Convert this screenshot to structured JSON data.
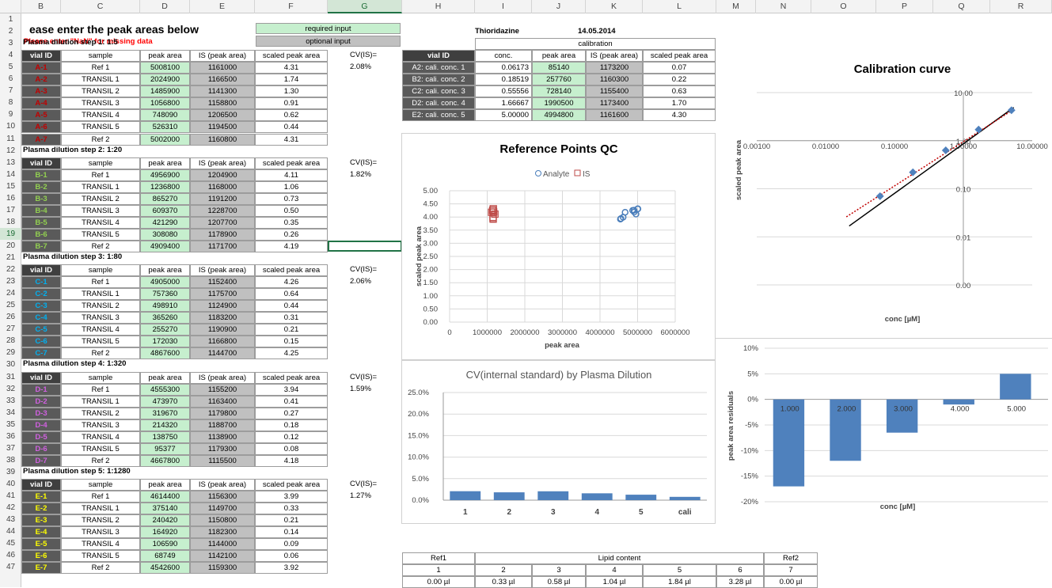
{
  "columns": [
    "",
    "B",
    "C",
    "D",
    "E",
    "F",
    "G",
    "H",
    "I",
    "J",
    "K",
    "L",
    "M",
    "N",
    "O",
    "P",
    "Q",
    "R"
  ],
  "rows": [
    "1",
    "2",
    "3",
    "4",
    "5",
    "6",
    "7",
    "8",
    "9",
    "10",
    "11",
    "12",
    "13",
    "14",
    "15",
    "16",
    "17",
    "18",
    "19",
    "20",
    "21",
    "22",
    "23",
    "24",
    "25",
    "26",
    "27",
    "28",
    "29",
    "30",
    "31",
    "32",
    "33",
    "34",
    "35",
    "36",
    "37",
    "38",
    "39",
    "40",
    "41",
    "42",
    "43",
    "44",
    "45",
    "46",
    "47"
  ],
  "title": "ease enter the peak areas below",
  "nan_note": "Please enter \"NaN\" for missing data",
  "legend_required": "required input",
  "legend_optional": "optional input",
  "drug": "Thioridazine",
  "date": "14.05.2014",
  "headers": {
    "vial": "vial ID",
    "sample": "sample",
    "peak": "peak area",
    "is": "IS (peak area)",
    "scaled": "scaled peak area",
    "cv": "CV(IS)="
  },
  "colors": {
    "A": "#c00000",
    "B": "#92d050",
    "C": "#00b0f0",
    "D": "#d060e0",
    "E": "#ffff00"
  },
  "steps": [
    {
      "label": "Plasma dilution step 1:  1:5",
      "cv": "2.08%",
      "rows": [
        [
          "A-1",
          "Ref 1",
          "5008100",
          "1161000",
          "4.31"
        ],
        [
          "A-2",
          "TRANSIL 1",
          "2024900",
          "1166500",
          "1.74"
        ],
        [
          "A-3",
          "TRANSIL 2",
          "1485900",
          "1141300",
          "1.30"
        ],
        [
          "A-4",
          "TRANSIL 3",
          "1056800",
          "1158800",
          "0.91"
        ],
        [
          "A-5",
          "TRANSIL 4",
          "748090",
          "1206500",
          "0.62"
        ],
        [
          "A-6",
          "TRANSIL 5",
          "526310",
          "1194500",
          "0.44"
        ],
        [
          "A-7",
          "Ref 2",
          "5002000",
          "1160800",
          "4.31"
        ]
      ]
    },
    {
      "label": "Plasma dilution step 2:  1:20",
      "cv": "1.82%",
      "rows": [
        [
          "B-1",
          "Ref 1",
          "4956900",
          "1204900",
          "4.11"
        ],
        [
          "B-2",
          "TRANSIL 1",
          "1236800",
          "1168000",
          "1.06"
        ],
        [
          "B-3",
          "TRANSIL 2",
          "865270",
          "1191200",
          "0.73"
        ],
        [
          "B-4",
          "TRANSIL 3",
          "609370",
          "1228700",
          "0.50"
        ],
        [
          "B-5",
          "TRANSIL 4",
          "421290",
          "1207700",
          "0.35"
        ],
        [
          "B-6",
          "TRANSIL 5",
          "308080",
          "1178900",
          "0.26"
        ],
        [
          "B-7",
          "Ref 2",
          "4909400",
          "1171700",
          "4.19"
        ]
      ]
    },
    {
      "label": "Plasma dilution step 3:  1:80",
      "cv": "2.06%",
      "rows": [
        [
          "C-1",
          "Ref 1",
          "4905000",
          "1152400",
          "4.26"
        ],
        [
          "C-2",
          "TRANSIL 1",
          "757360",
          "1175700",
          "0.64"
        ],
        [
          "C-3",
          "TRANSIL 2",
          "498910",
          "1124900",
          "0.44"
        ],
        [
          "C-4",
          "TRANSIL 3",
          "365260",
          "1183200",
          "0.31"
        ],
        [
          "C-5",
          "TRANSIL 4",
          "255270",
          "1190900",
          "0.21"
        ],
        [
          "C-6",
          "TRANSIL 5",
          "172030",
          "1166800",
          "0.15"
        ],
        [
          "C-7",
          "Ref 2",
          "4867600",
          "1144700",
          "4.25"
        ]
      ]
    },
    {
      "label": "Plasma dilution step 4:  1:320",
      "cv": "1.59%",
      "rows": [
        [
          "D-1",
          "Ref 1",
          "4555300",
          "1155200",
          "3.94"
        ],
        [
          "D-2",
          "TRANSIL 1",
          "473970",
          "1163400",
          "0.41"
        ],
        [
          "D-3",
          "TRANSIL 2",
          "319670",
          "1179800",
          "0.27"
        ],
        [
          "D-4",
          "TRANSIL 3",
          "214320",
          "1188700",
          "0.18"
        ],
        [
          "D-5",
          "TRANSIL 4",
          "138750",
          "1138900",
          "0.12"
        ],
        [
          "D-6",
          "TRANSIL 5",
          "95377",
          "1179300",
          "0.08"
        ],
        [
          "D-7",
          "Ref 2",
          "4667800",
          "1115500",
          "4.18"
        ]
      ]
    },
    {
      "label": "Plasma dilution step 5:  1:1280",
      "cv": "1.27%",
      "rows": [
        [
          "E-1",
          "Ref 1",
          "4614400",
          "1156300",
          "3.99"
        ],
        [
          "E-2",
          "TRANSIL 1",
          "375140",
          "1149700",
          "0.33"
        ],
        [
          "E-3",
          "TRANSIL 2",
          "240420",
          "1150800",
          "0.21"
        ],
        [
          "E-4",
          "TRANSIL 3",
          "164920",
          "1182300",
          "0.14"
        ],
        [
          "E-5",
          "TRANSIL 4",
          "106590",
          "1144000",
          "0.09"
        ],
        [
          "E-6",
          "TRANSIL 5",
          "68749",
          "1142100",
          "0.06"
        ],
        [
          "E-7",
          "Ref 2",
          "4542600",
          "1159300",
          "3.92"
        ]
      ]
    }
  ],
  "calibration": {
    "title": "calibration",
    "headers": [
      "vial ID",
      "conc.",
      "peak area",
      "IS (peak area)",
      "scaled peak area"
    ],
    "rows": [
      [
        "A2: cali. conc. 1",
        "0.06173",
        "85140",
        "1173200",
        "0.07"
      ],
      [
        "B2: cali. conc. 2",
        "0.18519",
        "257760",
        "1160300",
        "0.22"
      ],
      [
        "C2: cali. conc. 3",
        "0.55556",
        "728140",
        "1155400",
        "0.63"
      ],
      [
        "D2: cali. conc. 4",
        "1.66667",
        "1990500",
        "1173400",
        "1.70"
      ],
      [
        "E2: cali. conc. 5",
        "5.00000",
        "4994800",
        "1161600",
        "4.30"
      ]
    ]
  },
  "lipid": {
    "ref1": "Ref1",
    "lipid": "Lipid content",
    "ref2": "Ref2",
    "nums": [
      "1",
      "2",
      "3",
      "4",
      "5",
      "6",
      "7"
    ],
    "vals": [
      "0.00 µl",
      "0.33 µl",
      "0.58 µl",
      "1.04 µl",
      "1.84 µl",
      "3.28 µl",
      "0.00 µl"
    ]
  },
  "chart_data": [
    {
      "type": "scatter",
      "title": "Reference Points QC",
      "xlabel": "peak area",
      "ylabel": "scaled peak area",
      "xlim": [
        0,
        6000000
      ],
      "ylim": [
        0,
        5
      ],
      "xticks": [
        "0",
        "1000000",
        "2000000",
        "3000000",
        "4000000",
        "5000000",
        "6000000"
      ],
      "yticks": [
        "0.00",
        "0.50",
        "1.00",
        "1.50",
        "2.00",
        "2.50",
        "3.00",
        "3.50",
        "4.00",
        "4.50",
        "5.00"
      ],
      "legend_position": "top",
      "series": [
        {
          "name": "Analyte",
          "color": "#4a7ebb",
          "points": [
            [
              5008100,
              4.31
            ],
            [
              5002000,
              4.31
            ],
            [
              4956900,
              4.11
            ],
            [
              4909400,
              4.19
            ],
            [
              4905000,
              4.26
            ],
            [
              4867600,
              4.25
            ],
            [
              4555300,
              3.94
            ],
            [
              4667800,
              4.18
            ],
            [
              4614400,
              3.99
            ],
            [
              4542600,
              3.92
            ]
          ]
        },
        {
          "name": "IS",
          "color": "#be4b48",
          "points": [
            [
              1161000,
              4.31
            ],
            [
              1160800,
              4.31
            ],
            [
              1204900,
              4.11
            ],
            [
              1171700,
              4.19
            ],
            [
              1152400,
              4.26
            ],
            [
              1144700,
              4.25
            ],
            [
              1155200,
              3.94
            ],
            [
              1115500,
              4.18
            ],
            [
              1156300,
              3.99
            ],
            [
              1159300,
              3.92
            ]
          ]
        }
      ]
    },
    {
      "type": "bar",
      "title": "CV(internal standard) by Plasma Dilution",
      "categories": [
        "1",
        "2",
        "3",
        "4",
        "5",
        "cali"
      ],
      "values": [
        2.08,
        1.82,
        2.06,
        1.59,
        1.27,
        0.77
      ],
      "ylim": [
        0,
        25
      ],
      "yticks": [
        "0.0%",
        "5.0%",
        "10.0%",
        "15.0%",
        "20.0%",
        "25.0%"
      ],
      "color": "#4f81bd"
    },
    {
      "type": "line",
      "title": "Calibration curve",
      "scale": "log-log",
      "xlabel": "conc [µM]",
      "ylabel": "scaled peak area",
      "xticks": [
        "0.00100",
        "0.01000",
        "0.10000",
        "1.00000",
        "10.00000"
      ],
      "yticks": [
        "0.00",
        "0.01",
        "0.10",
        "1.00",
        "10.00"
      ],
      "points": [
        [
          0.06173,
          0.07
        ],
        [
          0.18519,
          0.22
        ],
        [
          0.55556,
          0.63
        ],
        [
          1.66667,
          1.7
        ],
        [
          5.0,
          4.3
        ]
      ],
      "color": "#4f81bd"
    },
    {
      "type": "bar",
      "title": "",
      "xlabel": "conc [µM]",
      "ylabel": "peak area residuals",
      "categories": [
        "1.000",
        "2.000",
        "3.000",
        "4.000",
        "5.000"
      ],
      "values": [
        -17,
        -12,
        -6.5,
        -1,
        5
      ],
      "ylim": [
        -20,
        10
      ],
      "yticks": [
        "10%",
        "5%",
        "0%",
        "-5%",
        "-10%",
        "-15%",
        "-20%"
      ],
      "color": "#4f81bd"
    }
  ]
}
